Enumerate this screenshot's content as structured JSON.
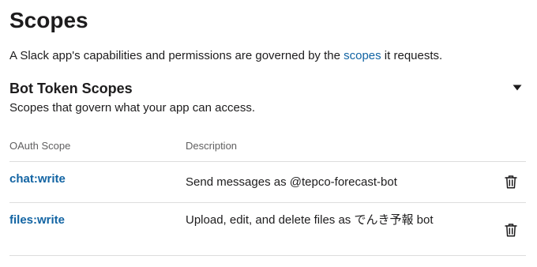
{
  "page": {
    "title": "Scopes",
    "intro_before": "A Slack app's capabilities and permissions are governed by the ",
    "intro_link": "scopes",
    "intro_after": " it requests."
  },
  "section": {
    "title": "Bot Token Scopes",
    "subtitle": "Scopes that govern what your app can access.",
    "toggle_icon": "caret-down-icon"
  },
  "table": {
    "headers": {
      "scope": "OAuth Scope",
      "description": "Description"
    },
    "rows": [
      {
        "scope": "chat:write",
        "description": "Send messages as @tepco-forecast-bot",
        "action_icon": "trash-icon"
      },
      {
        "scope": "files:write",
        "description": "Upload, edit, and delete files as でんき予報 bot",
        "action_icon": "trash-icon"
      }
    ]
  },
  "colors": {
    "link": "#1264a3",
    "text": "#1d1c1d",
    "muted": "#616061",
    "divider": "#dddddd"
  }
}
